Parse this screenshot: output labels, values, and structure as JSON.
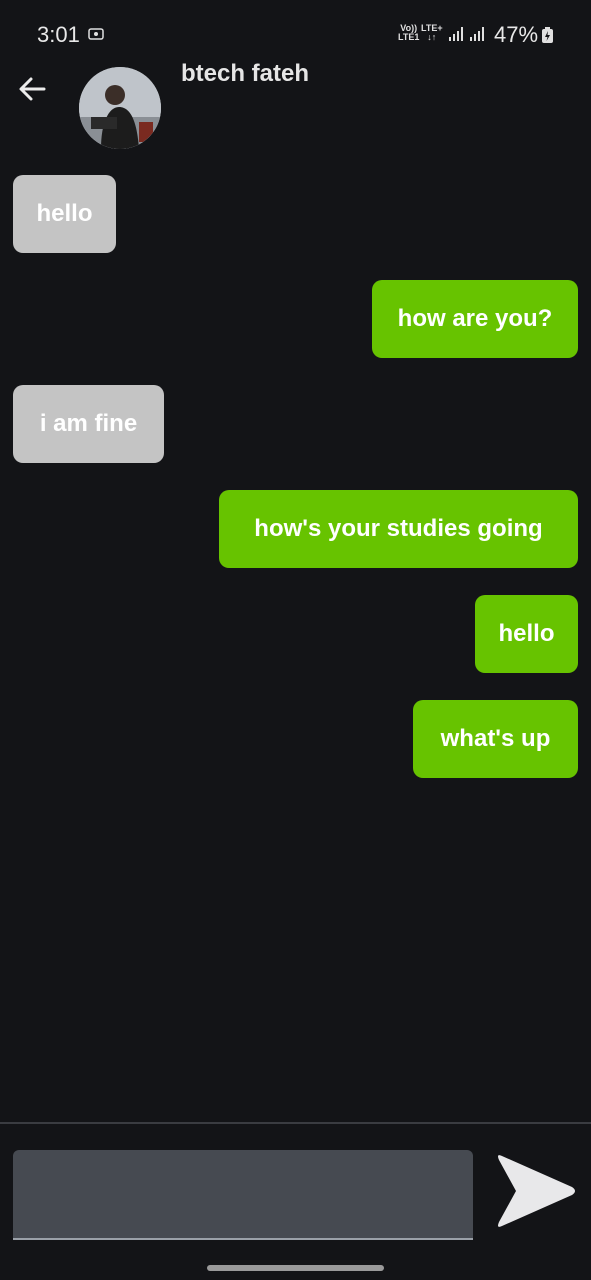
{
  "status_bar": {
    "time": "3:01",
    "volte_label": "Vo))\nLTE1",
    "lte_label": "LTE+\n↓↑",
    "battery": "47%"
  },
  "header": {
    "contact_name": "btech fateh"
  },
  "messages": [
    {
      "text": "hello",
      "direction": "incoming"
    },
    {
      "text": "how are you?",
      "direction": "outgoing"
    },
    {
      "text": "i am fine",
      "direction": "incoming"
    },
    {
      "text": "how's your studies going",
      "direction": "outgoing"
    },
    {
      "text": "hello",
      "direction": "outgoing"
    },
    {
      "text": "what's up",
      "direction": "outgoing"
    }
  ],
  "compose": {
    "value": "",
    "placeholder": ""
  },
  "colors": {
    "background": "#131417",
    "incoming_bubble": "#c4c4c4",
    "outgoing_bubble": "#67c300",
    "input_bg": "#464a51"
  },
  "icons": {
    "back": "arrow-left-icon",
    "send": "send-icon",
    "screen_record": "screen-record-icon",
    "battery": "battery-icon",
    "signal": "signal-icon"
  }
}
